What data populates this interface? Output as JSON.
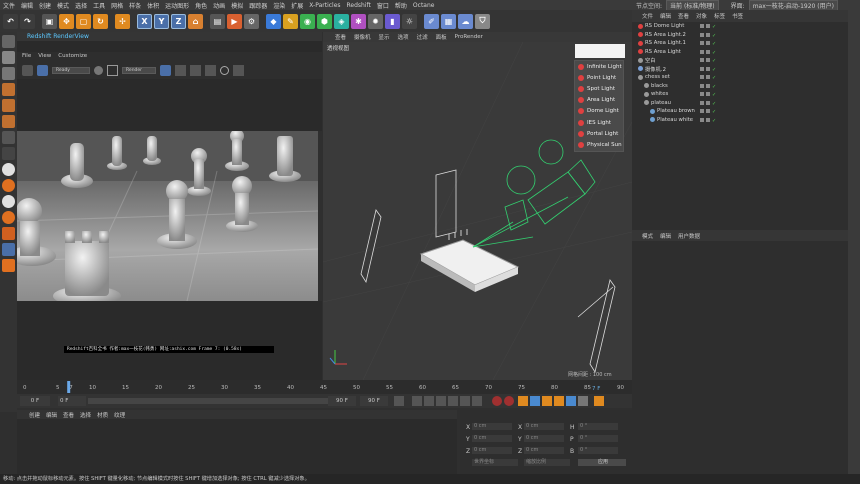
{
  "menubar": {
    "items": [
      "文件",
      "编辑",
      "创建",
      "模式",
      "选择",
      "工具",
      "网格",
      "样条",
      "体积",
      "运动图形",
      "角色",
      "动画",
      "模拟",
      "跟踪器",
      "渲染",
      "扩展",
      "X-Particles",
      "Redshift",
      "窗口",
      "帮助",
      "Octane"
    ]
  },
  "right_menu": {
    "node_space_label": "节点空间:",
    "node_space_value": "当前 (标准/物理)",
    "interface_label": "界面:",
    "interface_value": "max一枝花-启动-1920 (用户)"
  },
  "toolbar": {
    "axis_x": "X",
    "axis_y": "Y",
    "axis_z": "Z"
  },
  "renderview": {
    "title": "Redshift RenderView",
    "menu": [
      "File",
      "View",
      "Customize"
    ],
    "status_select": "Ready",
    "render_select": "Render",
    "footer": "Redshift百科全书  作者:max一枝花(韩勇)  网址:ashix.com  Frame  7:  (0.58s)"
  },
  "viewport": {
    "menu": [
      "查看",
      "摄像机",
      "显示",
      "选项",
      "过滤",
      "面板",
      "ProRender"
    ],
    "label": "透视视图",
    "grid_spacing": "网格间距 : 100 cm"
  },
  "light_menu": [
    "Infinite Light",
    "Point Light",
    "Spot Light",
    "Area Light",
    "Dome Light",
    "IES Light",
    "Portal Light",
    "Physical Sun"
  ],
  "object_manager": {
    "menu": [
      "文件",
      "编辑",
      "查看",
      "对象",
      "标签",
      "书签"
    ],
    "rows": [
      {
        "name": "RS Dome Light",
        "indent": 0,
        "color": "#e04040"
      },
      {
        "name": "RS Area Light.2",
        "indent": 0,
        "color": "#e04040"
      },
      {
        "name": "RS Area Light.1",
        "indent": 0,
        "color": "#e04040"
      },
      {
        "name": "RS Area Light",
        "indent": 0,
        "color": "#e04040"
      },
      {
        "name": "空白",
        "indent": 0,
        "color": "#9a9a9a"
      },
      {
        "name": "摄像机.2",
        "indent": 0,
        "color": "#7aa0d8"
      },
      {
        "name": "chess set",
        "indent": 0,
        "color": "#9a9a9a"
      },
      {
        "name": "blacks",
        "indent": 1,
        "color": "#9a9a9a"
      },
      {
        "name": "whites",
        "indent": 1,
        "color": "#9a9a9a"
      },
      {
        "name": "plateau",
        "indent": 1,
        "color": "#9a9a9a"
      },
      {
        "name": "Plateau brown",
        "indent": 2,
        "color": "#6fa0d0"
      },
      {
        "name": "Plateau white",
        "indent": 2,
        "color": "#6fa0d0"
      }
    ]
  },
  "attributes": {
    "menu": [
      "模式",
      "编辑",
      "用户数据"
    ]
  },
  "timeline": {
    "ticks": [
      "0",
      "5",
      "7",
      "10",
      "15",
      "20",
      "25",
      "30",
      "35",
      "40",
      "45",
      "50",
      "55",
      "60",
      "65",
      "70",
      "75",
      "80",
      "85",
      "90"
    ],
    "current_frame": "7 F",
    "start": "0 F",
    "current": "0 F",
    "end": "90 F",
    "end2": "90 F"
  },
  "material": {
    "menu": [
      "创建",
      "编辑",
      "查看",
      "选择",
      "材质",
      "纹理"
    ]
  },
  "coords": {
    "x": "X",
    "y": "Y",
    "z": "Z",
    "h": "H",
    "p": "P",
    "b": "B",
    "val_cm": "0 cm",
    "val_deg": "0 °",
    "world": "世界坐标",
    "scale": "缩放比例",
    "apply": "应用"
  },
  "status": "移动: 点击并拖动鼠标移动元素。按住 SHIFT 键量化移动; 节点编辑模式时按住 SHIFT 键增加选择对象; 按住 CTRL 键减少选择对象。"
}
